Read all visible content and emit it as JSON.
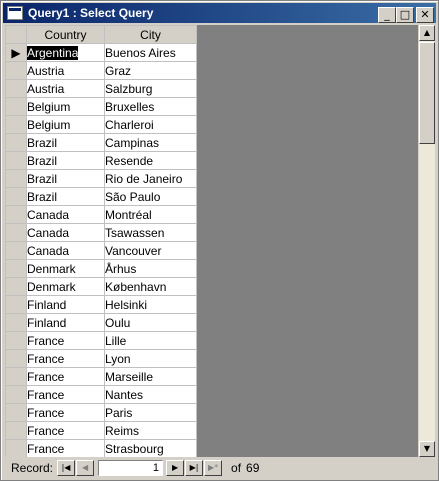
{
  "window": {
    "title": "Query1 : Select Query"
  },
  "title_buttons": {
    "minimize": "_",
    "maximize": "□",
    "close": "✕"
  },
  "columns": [
    "Country",
    "City"
  ],
  "current_row_indicator": "▶",
  "rows": [
    [
      "Argentina",
      "Buenos Aires"
    ],
    [
      "Austria",
      "Graz"
    ],
    [
      "Austria",
      "Salzburg"
    ],
    [
      "Belgium",
      "Bruxelles"
    ],
    [
      "Belgium",
      "Charleroi"
    ],
    [
      "Brazil",
      "Campinas"
    ],
    [
      "Brazil",
      "Resende"
    ],
    [
      "Brazil",
      "Rio de Janeiro"
    ],
    [
      "Brazil",
      "São Paulo"
    ],
    [
      "Canada",
      "Montréal"
    ],
    [
      "Canada",
      "Tsawassen"
    ],
    [
      "Canada",
      "Vancouver"
    ],
    [
      "Denmark",
      "Århus"
    ],
    [
      "Denmark",
      "København"
    ],
    [
      "Finland",
      "Helsinki"
    ],
    [
      "Finland",
      "Oulu"
    ],
    [
      "France",
      "Lille"
    ],
    [
      "France",
      "Lyon"
    ],
    [
      "France",
      "Marseille"
    ],
    [
      "France",
      "Nantes"
    ],
    [
      "France",
      "Paris"
    ],
    [
      "France",
      "Reims"
    ],
    [
      "France",
      "Strasbourg"
    ]
  ],
  "navigation": {
    "label": "Record:",
    "first": "|◀",
    "prev": "◀",
    "current": "1",
    "next": "▶",
    "last": "▶|",
    "new": "▶*",
    "of_label": "of",
    "total": "69"
  },
  "scrollbar": {
    "up": "▲",
    "down": "▼"
  }
}
